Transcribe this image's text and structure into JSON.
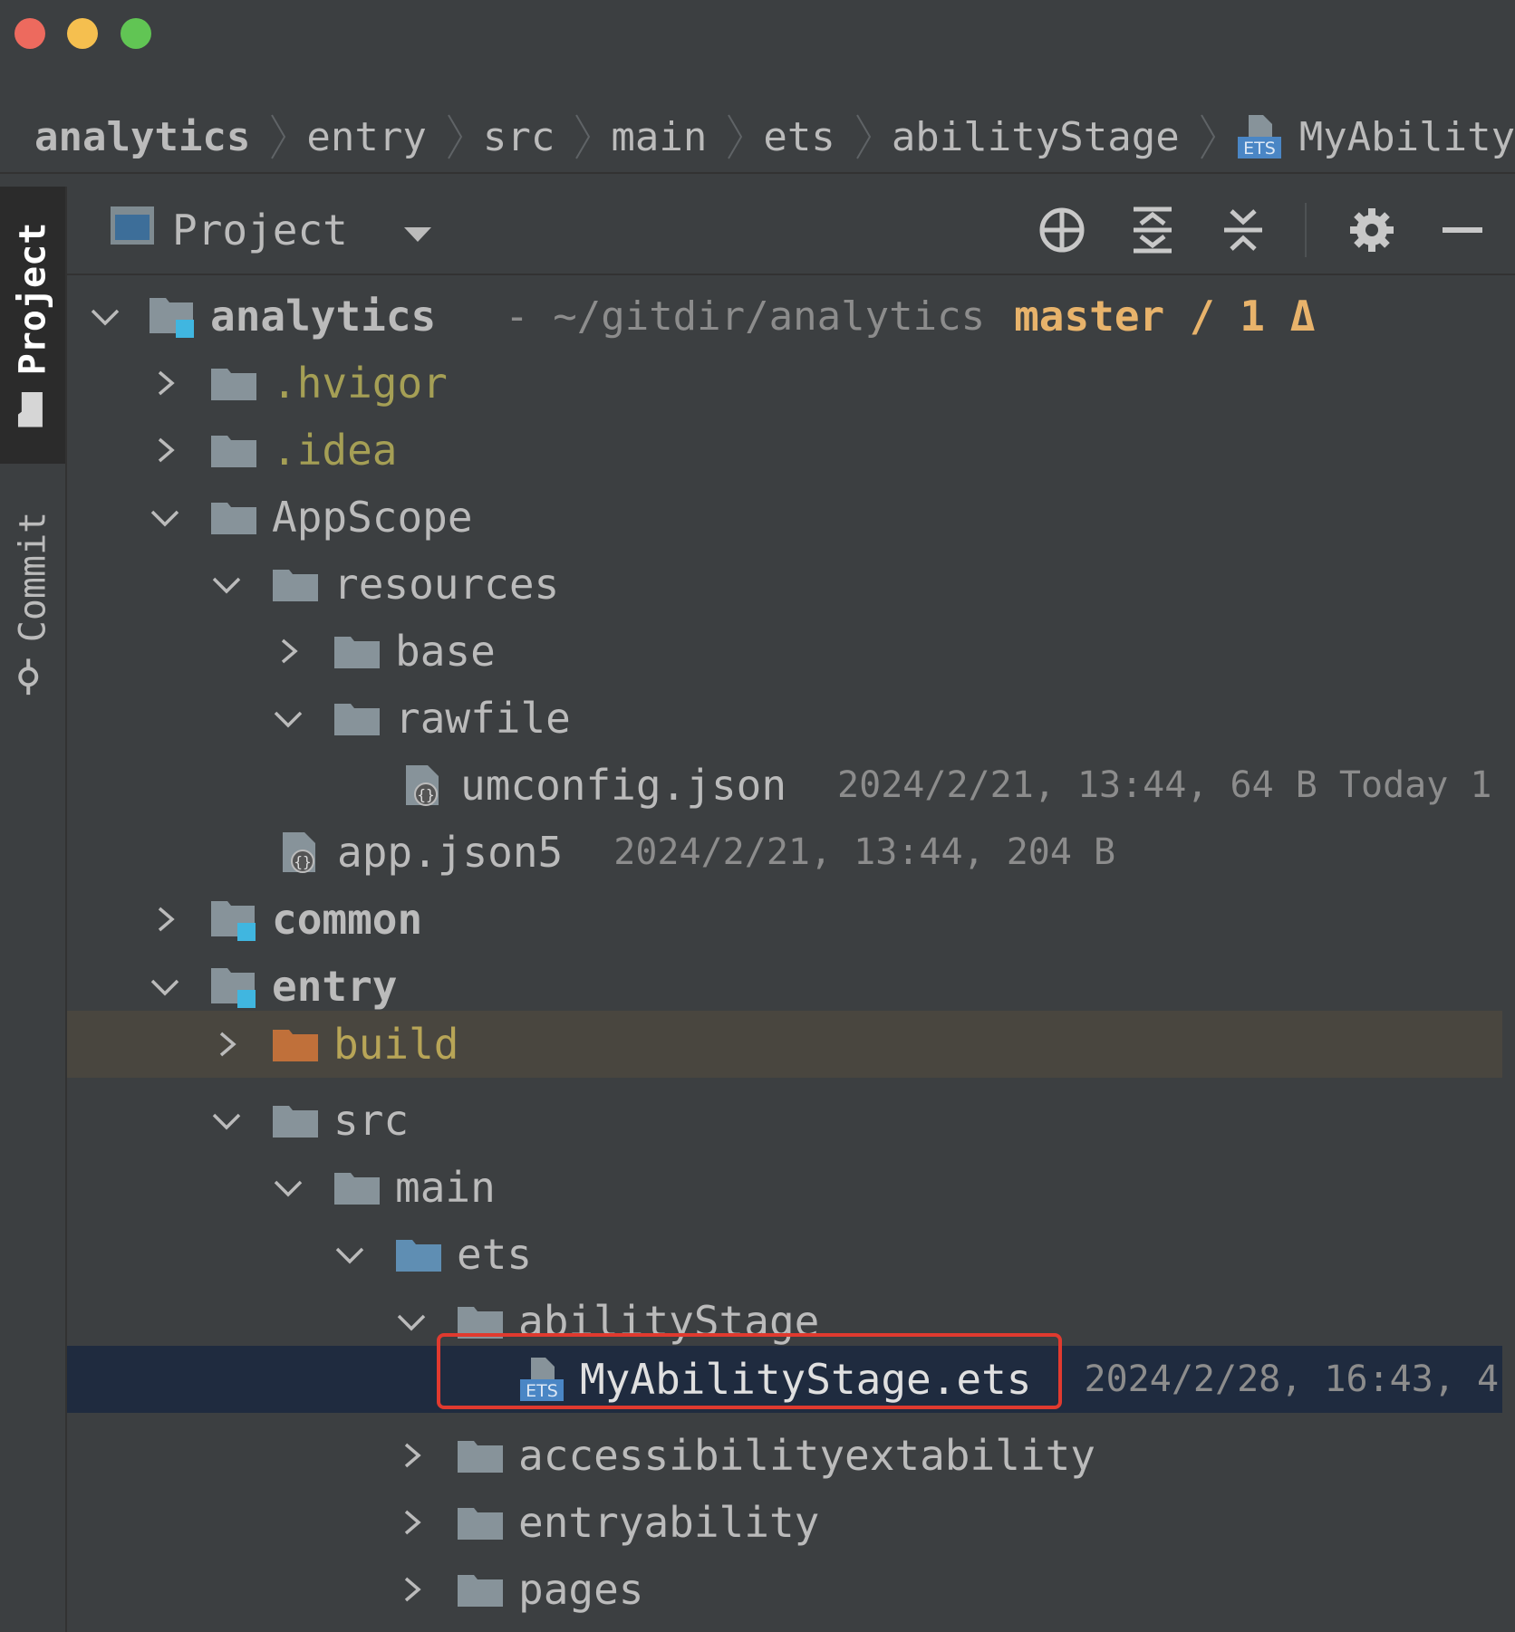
{
  "window": {
    "traffic_lights": [
      "close",
      "minimize",
      "maximize"
    ]
  },
  "breadcrumb": {
    "items": [
      "analytics",
      "entry",
      "src",
      "main",
      "ets",
      "abilityStage",
      "MyAbilityStage"
    ]
  },
  "tool_stripe": {
    "project_label": "Project",
    "commit_label": "Commit"
  },
  "panel": {
    "title": "Project",
    "tools": [
      "locate-icon",
      "expand-all-icon",
      "collapse-all-icon",
      "gear-icon",
      "hide-icon"
    ]
  },
  "tree": {
    "root": {
      "name": "analytics",
      "path": "- ~/gitdir/analytics",
      "branch": "master / 1 Δ"
    },
    "hvigor": ".hvigor",
    "idea": ".idea",
    "appscope": "AppScope",
    "resources": "resources",
    "base": "base",
    "rawfile": "rawfile",
    "umconfig": {
      "name": "umconfig.json",
      "meta": "2024/2/21, 13:44, 64 B Today 1"
    },
    "appjson": {
      "name": "app.json5",
      "meta": "2024/2/21, 13:44, 204 B"
    },
    "common": "common",
    "entry": "entry",
    "build": "build",
    "src": "src",
    "main": "main",
    "ets": "ets",
    "abilitystage": "abilityStage",
    "myabilitystage": {
      "name": "MyAbilityStage.ets",
      "meta": "2024/2/28, 16:43, 4"
    },
    "accessibility": "accessibilityextability",
    "entryability": "entryability",
    "pages": "pages"
  },
  "colors": {
    "background": "#3c3f41",
    "selected_row": "#1f2b3f",
    "excluded_row": "#49463f",
    "branch": "#e8b36b",
    "highlight_box": "#e03a2f"
  }
}
